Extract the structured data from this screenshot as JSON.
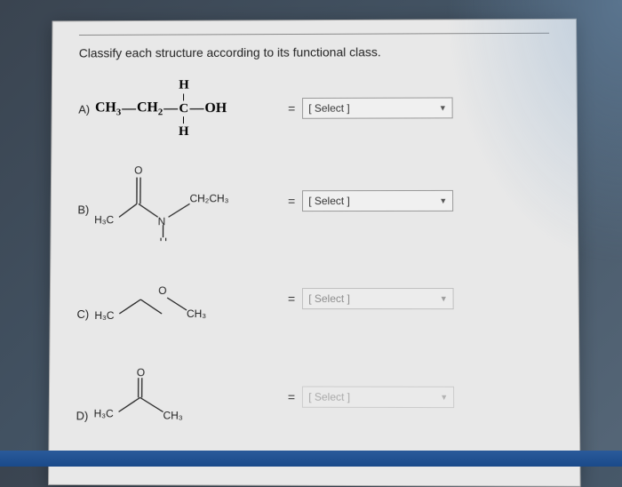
{
  "prompt": "Classify each structure according to its functional class.",
  "items": {
    "a": {
      "label": "A)",
      "formula_parts": {
        "h_top": "H",
        "h_bottom": "H",
        "line": "CH₃—CH₂—C—OH"
      },
      "equals": "=",
      "select_text": "[ Select ]"
    },
    "b": {
      "label": "B)",
      "struct": {
        "h3c": "H₃C",
        "o": "O",
        "n": "N",
        "h": "H",
        "ch2ch3": "CH₂CH₃"
      },
      "equals": "=",
      "select_text": "[ Select ]"
    },
    "c": {
      "label": "C)",
      "struct": {
        "h3c": "H₃C",
        "o": "O",
        "ch3": "CH₃"
      },
      "equals": "=",
      "select_text": "[ Select ]"
    },
    "d": {
      "label": "D)",
      "struct": {
        "h3c": "H₃C",
        "o": "O",
        "ch3": "CH₃"
      },
      "equals": "=",
      "select_text": "[ Select ]"
    }
  }
}
